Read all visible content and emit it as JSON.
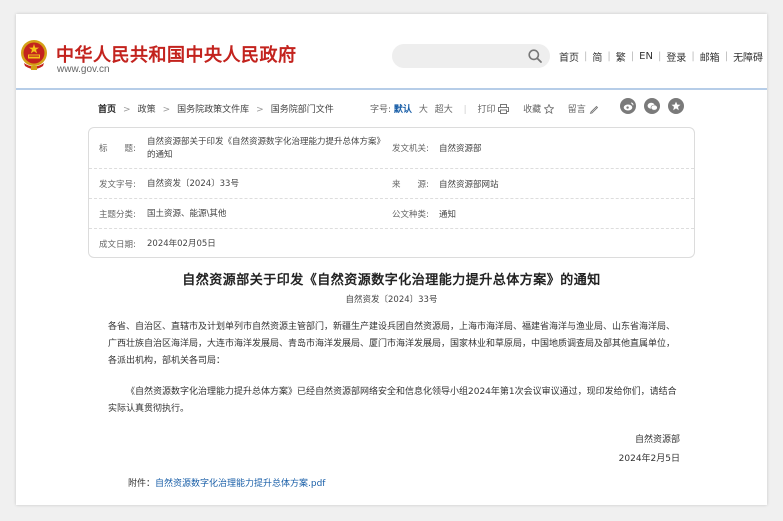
{
  "header": {
    "site_title": "中华人民共和国中央人民政府",
    "site_url": "www.gov.cn",
    "search_placeholder": "",
    "nav": [
      "首页",
      "简",
      "繁",
      "EN",
      "登录",
      "邮箱",
      "无障碍"
    ]
  },
  "breadcrumb": {
    "items": [
      "首页",
      "政策",
      "国务院政策文件库",
      "国务院部门文件"
    ]
  },
  "tools": {
    "font_label": "字号:",
    "font_default": "默认",
    "font_large": "大",
    "font_xlarge": "超大",
    "print": "打印",
    "favorite": "收藏",
    "comment": "留言"
  },
  "share_icons": [
    "weibo-icon",
    "wechat-icon",
    "star-icon"
  ],
  "info": {
    "title_label": "标　　题:",
    "title_value": "自然资源部关于印发《自然资源数字化治理能力提升总体方案》的通知",
    "issuer_label": "发文机关:",
    "issuer_value": "自然资源部",
    "docno_label": "发文字号:",
    "docno_value": "自然资发〔2024〕33号",
    "source_label": "来　　源:",
    "source_value": "自然资源部网站",
    "topic_label": "主题分类:",
    "topic_value": "国土资源、能源\\其他",
    "type_label": "公文种类:",
    "type_value": "通知",
    "date_label": "成文日期:",
    "date_value": "2024年02月05日"
  },
  "article": {
    "title": "自然资源部关于印发《自然资源数字化治理能力提升总体方案》的通知",
    "doc_no": "自然资发〔2024〕33号",
    "p1": "各省、自治区、直辖市及计划单列市自然资源主管部门，新疆生产建设兵团自然资源局，上海市海洋局、福建省海洋与渔业局、山东省海洋局、广西壮族自治区海洋局，大连市海洋发展局、青岛市海洋发展局、厦门市海洋发展局，国家林业和草原局，中国地质调查局及部其他直属单位，各派出机构，部机关各司局：",
    "p2": "《自然资源数字化治理能力提升总体方案》已经自然资源部网络安全和信息化领导小组2024年第1次会议审议通过，现印发给你们，请结合实际认真贯彻执行。",
    "signer": "自然资源部",
    "sign_date": "2024年2月5日",
    "attachment_label": "附件：",
    "attachment_link": "自然资源数字化治理能力提升总体方案.pdf"
  },
  "colors": {
    "brand_red": "#c3231e",
    "link_blue": "#1a5fa8",
    "header_line": "#b6cde8"
  }
}
